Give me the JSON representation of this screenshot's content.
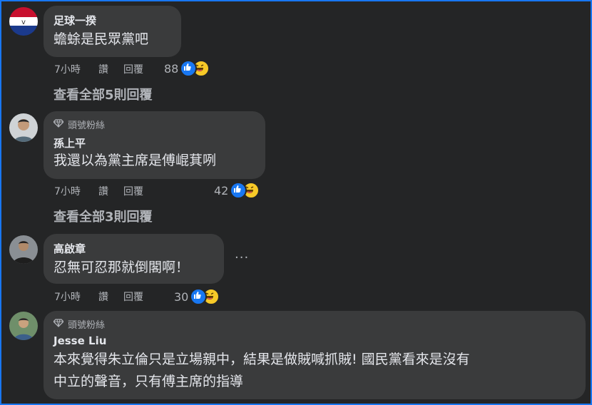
{
  "comments": [
    {
      "author": "足球一揆",
      "text": "蟾蜍是民眾黨吧",
      "time": "7小時",
      "like_label": "讚",
      "reply_label": "回覆",
      "reaction_count": "88",
      "view_replies": "查看全部5則回覆"
    },
    {
      "badge": "頭號粉絲",
      "author": "孫上平",
      "text": "我還以為黨主席是傅崐萁咧",
      "time": "7小時",
      "like_label": "讚",
      "reply_label": "回覆",
      "reaction_count": "42",
      "view_replies": "查看全部3則回覆"
    },
    {
      "author": "高啟章",
      "text": "忍無可忍那就倒閣啊！",
      "time": "7小時",
      "like_label": "讚",
      "reply_label": "回覆",
      "reaction_count": "30",
      "more_options": "···"
    },
    {
      "badge": "頭號粉絲",
      "author": "Jesse Liu",
      "text_line1": "本來覺得朱立倫只是立場親中，結果是做賊喊抓賊! 國民黨看來是沒有",
      "text_line2": "中立的聲音，只有傅主席的指導"
    }
  ],
  "colors": {
    "background": "#242526",
    "bubble": "#3a3b3c",
    "text": "#e4e6eb",
    "secondary": "#b0b3b8",
    "like": "#1877f2",
    "haha": "#f7c928",
    "frame": "#1877f2"
  },
  "icons": [
    "like-reaction-icon",
    "haha-reaction-icon",
    "diamond-icon",
    "more-options-icon"
  ]
}
